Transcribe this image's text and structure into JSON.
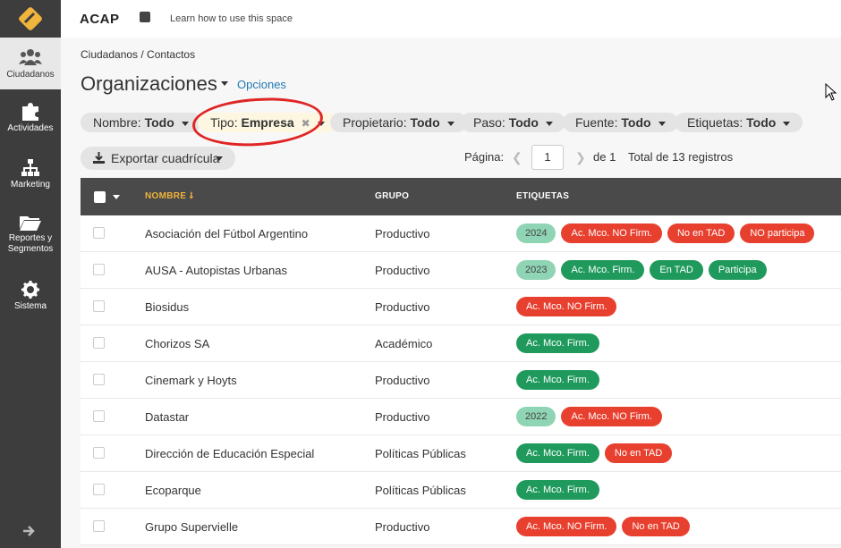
{
  "sidebar": {
    "items": [
      {
        "label": "Ciudadanos",
        "icon": "people-icon"
      },
      {
        "label": "Actividades",
        "icon": "puzzle-icon"
      },
      {
        "label": "Marketing",
        "icon": "sitemap-icon"
      },
      {
        "label_line1": "Reportes y",
        "label_line2": "Segmentos",
        "icon": "folder-icon"
      },
      {
        "label": "Sistema",
        "icon": "gear-icon"
      }
    ]
  },
  "topbar": {
    "app_title": "ACAP",
    "learn_link": "Learn how to use this space"
  },
  "breadcrumb": "Ciudadanos / Contactos",
  "page": {
    "title": "Organizaciones",
    "options_link": "Opciones"
  },
  "filters": [
    {
      "label": "Nombre:",
      "value": "Todo"
    },
    {
      "label": "Tipo:",
      "value": "Empresa"
    },
    {
      "label": "Propietario:",
      "value": "Todo"
    },
    {
      "label": "Paso:",
      "value": "Todo"
    },
    {
      "label": "Fuente:",
      "value": "Todo"
    },
    {
      "label": "Etiquetas:",
      "value": "Todo"
    }
  ],
  "export_label": "Exportar cuadrícula",
  "pager": {
    "label": "Página:",
    "current": "1",
    "of": "de 1",
    "total": "Total de 13 registros"
  },
  "table": {
    "headers": [
      "NOMBRE",
      "GRUPO",
      "ETIQUETAS"
    ],
    "rows": [
      {
        "name": "Asociación del Fútbol Argentino",
        "group": "Productivo",
        "tags": [
          {
            "text": "2024",
            "kind": "year"
          },
          {
            "text": "Ac. Mco. NO Firm.",
            "kind": "red"
          },
          {
            "text": "No en TAD",
            "kind": "red"
          },
          {
            "text": "NO participa",
            "kind": "red"
          }
        ]
      },
      {
        "name": "AUSA - Autopistas Urbanas",
        "group": "Productivo",
        "tags": [
          {
            "text": "2023",
            "kind": "year"
          },
          {
            "text": "Ac. Mco. Firm.",
            "kind": "green"
          },
          {
            "text": "En TAD",
            "kind": "green"
          },
          {
            "text": "Participa",
            "kind": "green"
          }
        ]
      },
      {
        "name": "Biosidus",
        "group": "Productivo",
        "tags": [
          {
            "text": "Ac. Mco. NO Firm.",
            "kind": "red"
          }
        ]
      },
      {
        "name": "Chorizos SA",
        "group": "Académico",
        "tags": [
          {
            "text": "Ac. Mco. Firm.",
            "kind": "green"
          }
        ]
      },
      {
        "name": "Cinemark y Hoyts",
        "group": "Productivo",
        "tags": [
          {
            "text": "Ac. Mco. Firm.",
            "kind": "green"
          }
        ]
      },
      {
        "name": "Datastar",
        "group": "Productivo",
        "tags": [
          {
            "text": "2022",
            "kind": "year"
          },
          {
            "text": "Ac. Mco. NO Firm.",
            "kind": "red"
          }
        ]
      },
      {
        "name": "Dirección de Educación Especial",
        "group": "Políticas Públicas",
        "tags": [
          {
            "text": "Ac. Mco. Firm.",
            "kind": "green"
          },
          {
            "text": "No en TAD",
            "kind": "red"
          }
        ]
      },
      {
        "name": "Ecoparque",
        "group": "Políticas Públicas",
        "tags": [
          {
            "text": "Ac. Mco. Firm.",
            "kind": "green"
          }
        ]
      },
      {
        "name": "Grupo Supervielle",
        "group": "Productivo",
        "tags": [
          {
            "text": "Ac. Mco. NO Firm.",
            "kind": "red"
          },
          {
            "text": "No en TAD",
            "kind": "red"
          }
        ]
      }
    ]
  },
  "colors": {
    "sidebar": "#3d3d3d",
    "accent": "#f0b43c",
    "tag_red": "#e8402f",
    "tag_green": "#1f9a5c",
    "tag_year": "#8fd4b4",
    "annotation_circle": "#e02525"
  }
}
